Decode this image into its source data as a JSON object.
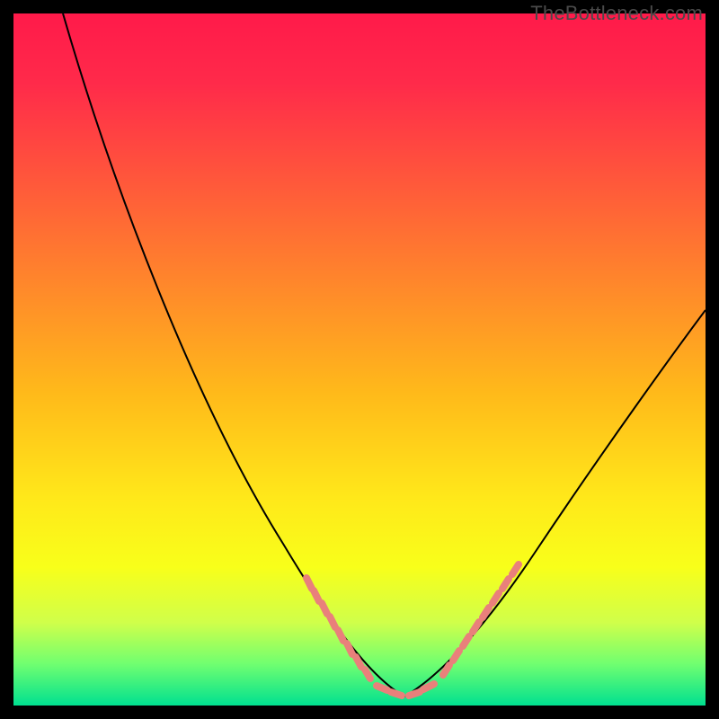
{
  "watermark": "TheBottleneck.com",
  "colors": {
    "gradient_top": "#ff1a4a",
    "gradient_bottom": "#00e090",
    "tick": "#e9807b",
    "curve": "#000000",
    "frame": "#000000"
  },
  "chart_data": {
    "type": "line",
    "title": "",
    "xlabel": "",
    "ylabel": "",
    "xlim": [
      0,
      100
    ],
    "ylim": [
      0,
      100
    ],
    "x": [
      7,
      15,
      25,
      35,
      42,
      48,
      52,
      56,
      62,
      70,
      80,
      90,
      100
    ],
    "values": [
      100,
      75,
      48,
      28,
      18,
      8,
      2,
      1,
      8,
      20,
      38,
      50,
      57
    ],
    "annotations": {
      "tick_markers": {
        "left_cluster_x_range": [
          42,
          52
        ],
        "bottom_cluster_x_range": [
          52,
          61
        ],
        "right_cluster_x_range": [
          62,
          73
        ]
      },
      "watermark": "TheBottleneck.com"
    },
    "background": "vertical gradient red→yellow→green",
    "grid": false,
    "legend": "none"
  }
}
